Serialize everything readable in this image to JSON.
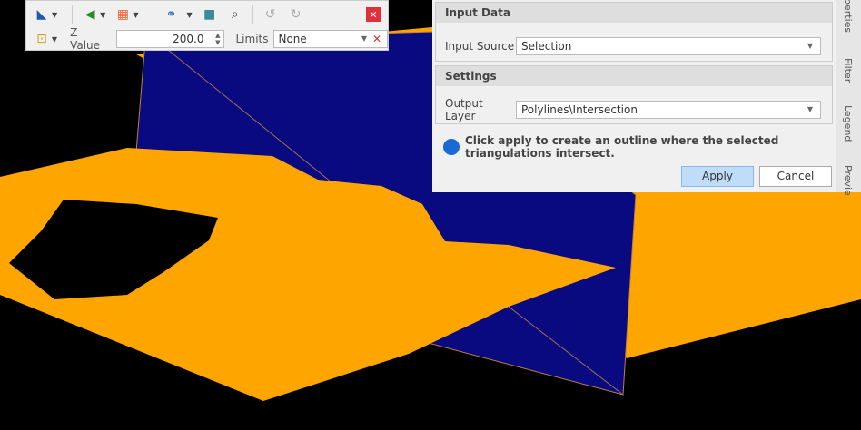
{
  "toolbar": {
    "z_label": "Z Value",
    "z_value": "200.0",
    "limits_label": "Limits",
    "limits_value": "None",
    "icons": [
      "measure-icon",
      "eye-icon",
      "grid-select-icon",
      "binoculars-refresh-icon",
      "box-binoculars-icon",
      "zoom-selection-icon",
      "undo-icon",
      "redo-icon",
      "close-icon",
      "bounding-box-icon"
    ]
  },
  "panel": {
    "input_data": {
      "title": "Input Data",
      "source_label": "Input Source",
      "source_value": "Selection"
    },
    "settings": {
      "title": "Settings",
      "output_label": "Output Layer",
      "output_value": "Polylines\\Intersection"
    },
    "info_text": "Click apply to create an outline where the selected triangulations intersect.",
    "apply": "Apply",
    "cancel": "Cancel"
  },
  "side_tabs": [
    "perties",
    "Filter",
    "Legend",
    "Previe"
  ],
  "colors": {
    "surface": "#ffa500",
    "plane": "#0a0a80",
    "info": "#1a6ad6"
  }
}
